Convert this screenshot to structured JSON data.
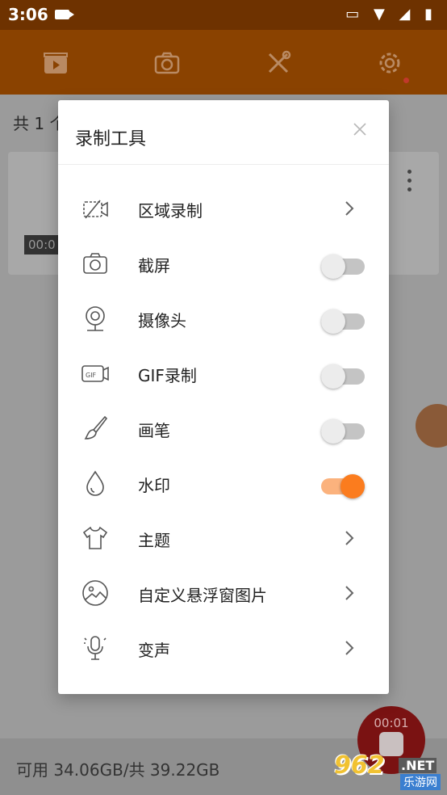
{
  "status_bar": {
    "time": "3:06",
    "system_icons": [
      "cast-icon",
      "wifi-icon",
      "signal-icon",
      "battery-icon"
    ]
  },
  "toolbar": {
    "tabs": [
      "video-tab-icon",
      "camera-tab-icon",
      "tools-tab-icon",
      "settings-tab-icon"
    ],
    "settings_has_badge": true
  },
  "background": {
    "count_label": "共 1 个",
    "video_duration": "00:0",
    "storage": "可用 34.06GB/共 39.22GB",
    "recording_time": "00:01"
  },
  "dialog": {
    "title": "录制工具",
    "items": [
      {
        "icon": "area-record-icon",
        "label": "区域录制",
        "control": "chevron"
      },
      {
        "icon": "camera-icon",
        "label": "截屏",
        "control": "toggle",
        "on": false
      },
      {
        "icon": "webcam-icon",
        "label": "摄像头",
        "control": "toggle",
        "on": false
      },
      {
        "icon": "gif-icon",
        "label": "GIF录制",
        "control": "toggle",
        "on": false
      },
      {
        "icon": "brush-icon",
        "label": "画笔",
        "control": "toggle",
        "on": false
      },
      {
        "icon": "water-drop-icon",
        "label": "水印",
        "control": "toggle",
        "on": true
      },
      {
        "icon": "tshirt-icon",
        "label": "主题",
        "control": "chevron"
      },
      {
        "icon": "image-icon",
        "label": "自定义悬浮窗图片",
        "control": "chevron"
      },
      {
        "icon": "voice-changer-icon",
        "label": "变声",
        "control": "chevron"
      }
    ]
  },
  "watermark": {
    "main": "962",
    "net": ".NET",
    "sub": "乐游网"
  },
  "colors": {
    "accent": "#fb7c1e",
    "toolbar": "#8a4200",
    "record": "#7a1212"
  }
}
